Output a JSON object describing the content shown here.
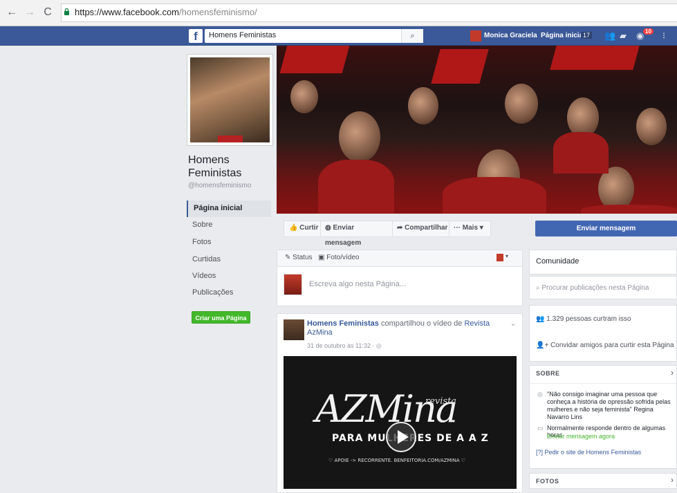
{
  "browser": {
    "url_host": "https://www.facebook.com",
    "url_path": "/homensfeminismo/"
  },
  "fb_topbar": {
    "search_value": "Homens Feministas",
    "user_name": "Monica Graciela",
    "home_label": "Página inicial",
    "home_count": "17",
    "notifications_count": "10"
  },
  "page": {
    "name_line1": "Homens",
    "name_line2": "Feministas",
    "handle": "@homensfeminismo"
  },
  "left_nav": {
    "items": [
      {
        "label": "Página inicial",
        "active": true
      },
      {
        "label": "Sobre"
      },
      {
        "label": "Fotos"
      },
      {
        "label": "Curtidas"
      },
      {
        "label": "Vídeos"
      },
      {
        "label": "Publicações"
      }
    ],
    "create_page_label": "Criar uma Página"
  },
  "actions": {
    "like": "Curtir",
    "send_message": "Enviar mensagem",
    "share": "Compartilhar",
    "more": "Mais",
    "send_message_primary": "Enviar mensagem"
  },
  "composer": {
    "tab_status": "Status",
    "tab_photo": "Foto/vídeo",
    "placeholder": "Escreva algo nesta Página..."
  },
  "post": {
    "author": "Homens Feministas",
    "shared_text": "compartilhou o vídeo de",
    "source": "Revista AzMina",
    "timestamp": "31 de outubro às 11:32 ·",
    "video": {
      "title_main": "AZMina",
      "title_small": "revista",
      "subtitle": "PARA MULHERES DE A A Z",
      "footer": "♡ APOIE -> RECORRENTE. BENFEITORIA.COM/AZMINA ♡"
    }
  },
  "sidebar": {
    "community_title": "Comunidade",
    "search_placeholder": "Procurar publicações nesta Página",
    "likes_text": "1.329 pessoas curtram isso",
    "invite_text": "Convidar amigos para curtir esta Página",
    "about_title": "SOBRE",
    "about_quote": "\"Não consigo imaginar uma pessoa que conheça a história de opressão sofrida pelas mulheres e não seja feminista\" Regina Navarro Lins",
    "response_text": "Normalmente responde dentro de algumas horas",
    "send_now": "Enviar mensagem agora",
    "site_link": "Pedir o site de Homens Feministas",
    "photos_title": "FOTOS"
  },
  "colors": {
    "fb_blue": "#3b5998",
    "primary_button": "#4267b2",
    "green": "#42b72a",
    "link": "#365899"
  }
}
